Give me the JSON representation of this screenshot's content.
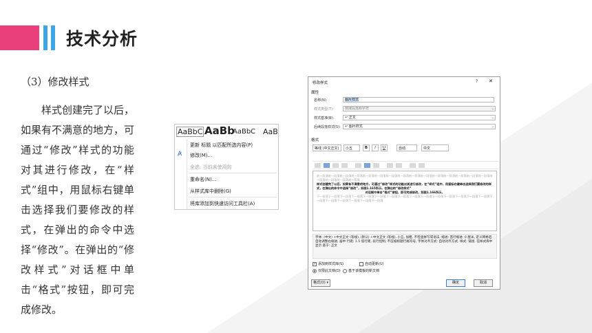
{
  "page": {
    "title": "技术分析",
    "subheading": "（3）修改样式",
    "body": "样式创建完了以后，如果有不满意的地方，可通过“修改”样式的功能对其进行修改，在“样式”组中，用鼠标右键单击选择我们要修改的样式，在弹出的命令中选择“修改”。在弹出的“修改样式”对话框中单击“格式”按钮，即可完成修改。"
  },
  "colors": {
    "accent_pink": "#e83f7b",
    "accent_blue": "#3ea6e6"
  },
  "context_menu": {
    "style_samples": [
      "AaBbC",
      "AaBb",
      "AaBbC",
      "AaB"
    ],
    "items": [
      {
        "label": "更新 标题 以匹配所选内容(P)",
        "icon": "",
        "enabled": true
      },
      {
        "label": "修改(M)...",
        "icon": "modify-icon",
        "enabled": true
      },
      {
        "label": "全选: 当前未使用的",
        "icon": "",
        "enabled": false
      },
      {
        "label": "重命名(N)...",
        "icon": "",
        "enabled": true
      },
      {
        "label": "从样式库中删除(G)",
        "icon": "",
        "enabled": true
      },
      {
        "label": "将库添加到快速访问工具栏(A)",
        "icon": "",
        "enabled": true
      }
    ]
  },
  "dialog": {
    "title": "修改样式",
    "help": "?",
    "close": "✕",
    "group_properties": "属性",
    "name_label": "名称(N):",
    "name_value": "图片样式",
    "type_label": "样式类型(T):",
    "type_value": "链接段落和字符",
    "based_label": "样式基准(B):",
    "based_value": "↵ 正文",
    "next_label": "后续段落样式(S):",
    "next_value": "↵ 图片样式",
    "group_format": "格式",
    "font_value": "等线 (中文正文)",
    "size_value": "小五",
    "bold": "B",
    "italic": "I",
    "underline": "U",
    "color_value": "自动",
    "lang_value": "中文",
    "preview_prev": "前一段落前一段落前一段落前一段落前一段落前一段落前一段落前一段落前一段落前一段落前一段落前一段落前一段落前一段落前一段落前一段落前一段落前一段落前一段落",
    "preview_line1": "样式创建完了以后，如果有不满意的地方，可通过“修改”样式的功能对其进行修改，在“样式”组中，用鼠标右键单击选择我们要修改的样式，在弹出的命令中选择“修改”，如图1.165所示。在弹出的“修改样式”",
    "preview_line2": "对话框中单击“格式”按钮，即可完成修改，如图1.166所示。",
    "preview_next": "下一段落下一段落下一段落下一段落下一段落下一段落下一段落下一段落下一段落下一段落下一段落下一段落下一段落下一段落下一段落下一段落下一段落下一段落下一段落下一段落下一段落",
    "description": "字体: (中文) +中文正文 (等线), (默认) +中文正文 (等线), 小五, 加粗, 不检查拼写或语法, 缩进: 首行缩进: 0 厘米, 定义网格后自动调整右缩进, 居中 行距: 1.5 倍行距, 段行控制, 不压缩标题行尾符号, 字体对齐方式: 自动对齐方式, 样式: 链接, 在样式库中显示 基于: 正文",
    "add_gallery": "添加到样式库(S)",
    "auto_update": "自动更新(U)",
    "only_doc": "仅限此文档(D)",
    "new_docs": "基于该模板的新文档",
    "format_button": "格式(O) ▾",
    "ok_button": "确定",
    "cancel_button": "取消"
  }
}
